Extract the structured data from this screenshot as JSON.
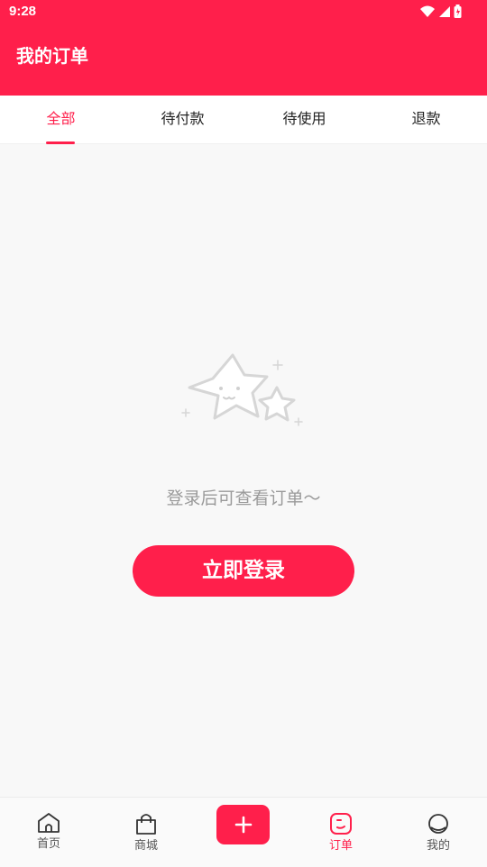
{
  "status_bar": {
    "time": "9:28"
  },
  "header": {
    "title": "我的订单"
  },
  "tabs": [
    {
      "label": "全部",
      "active": true
    },
    {
      "label": "待付款",
      "active": false
    },
    {
      "label": "待使用",
      "active": false
    },
    {
      "label": "退款",
      "active": false
    }
  ],
  "empty_state": {
    "illustration": "star-icon",
    "message": "登录后可查看订单～",
    "login_button": "立即登录"
  },
  "bottom_nav": [
    {
      "label": "首页",
      "icon": "home-icon",
      "active": false
    },
    {
      "label": "商城",
      "icon": "shopping-bag-icon",
      "active": false
    },
    {
      "label": "",
      "icon": "plus-icon",
      "active": false
    },
    {
      "label": "订单",
      "icon": "order-icon",
      "active": true
    },
    {
      "label": "我的",
      "icon": "profile-icon",
      "active": false
    }
  ],
  "colors": {
    "brand": "#ff1f4b",
    "background": "#f8f8f8",
    "muted_text": "#9a9a9a"
  }
}
